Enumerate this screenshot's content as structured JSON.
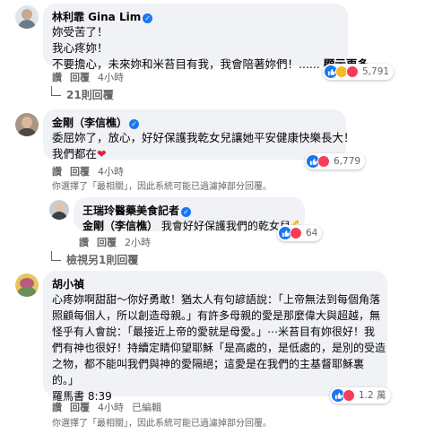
{
  "comments": [
    {
      "author": "林利霏 Gina Lim",
      "lines": [
        "妳受苦了！",
        "我心疼妳！",
        "不要擔心，未來妳和米苔目有我，我會陪著妳們！......"
      ],
      "see_more": "顯示更多",
      "actions": {
        "like": "讚",
        "reply": "回覆",
        "time": "4小時"
      },
      "reactions": "5,791",
      "view_replies": "21則回覆"
    },
    {
      "author": "金剛（李信樵）",
      "lines": [
        "委屈妳了，放心，好好保護我乾女兒讓她平安健康快樂長大！",
        "我們都在"
      ],
      "heart": "❤",
      "actions": {
        "like": "讚",
        "reply": "回覆",
        "time": "4小時"
      },
      "reactions": "6,779",
      "filter_note": "你選擇了「最相關」，因此系統可能已過濾掉部分回覆。"
    },
    {
      "author": "王瑞玲醫藥美食記者",
      "mention": "金剛（李信樵）",
      "text": "我會好好保護我們的乾女兒",
      "emoji": "💪",
      "actions": {
        "like": "讚",
        "reply": "回覆",
        "time": "2小時"
      },
      "reactions": "64",
      "view_replies": "檢視另1則回覆"
    },
    {
      "author": "胡小禎",
      "lines": [
        "心疼妳啊甜甜～你好勇敢！猶太人有句諺語說：「上帝無法到每個角落",
        "照顧每個人，所以創造母親。」有許多母親的愛是那麼偉大與超越，無",
        "怪乎有人會說：「最接近上帝的愛就是母愛。」⋯米苔目有妳很好！我",
        "們有神也很好！持續定睛仰望耶穌「是高處的，是低處的，是別的受造",
        "之物，都不能叫我們與神的愛隔絕；這愛是在我們的主基督耶穌裏",
        "的。」",
        "羅馬書 8:39"
      ],
      "actions": {
        "like": "讚",
        "reply": "回覆",
        "time": "4小時",
        "edited": "已編輯"
      },
      "reactions": "1.2 萬",
      "filter_note": "你選擇了「最相關」，因此系統可能已過濾掉部分回覆。"
    }
  ],
  "colors": {
    "bubble": "#f0f2f5",
    "meta": "#65676b",
    "like": "#1877f2",
    "love": "#f33e58",
    "haha": "#f7b928"
  }
}
